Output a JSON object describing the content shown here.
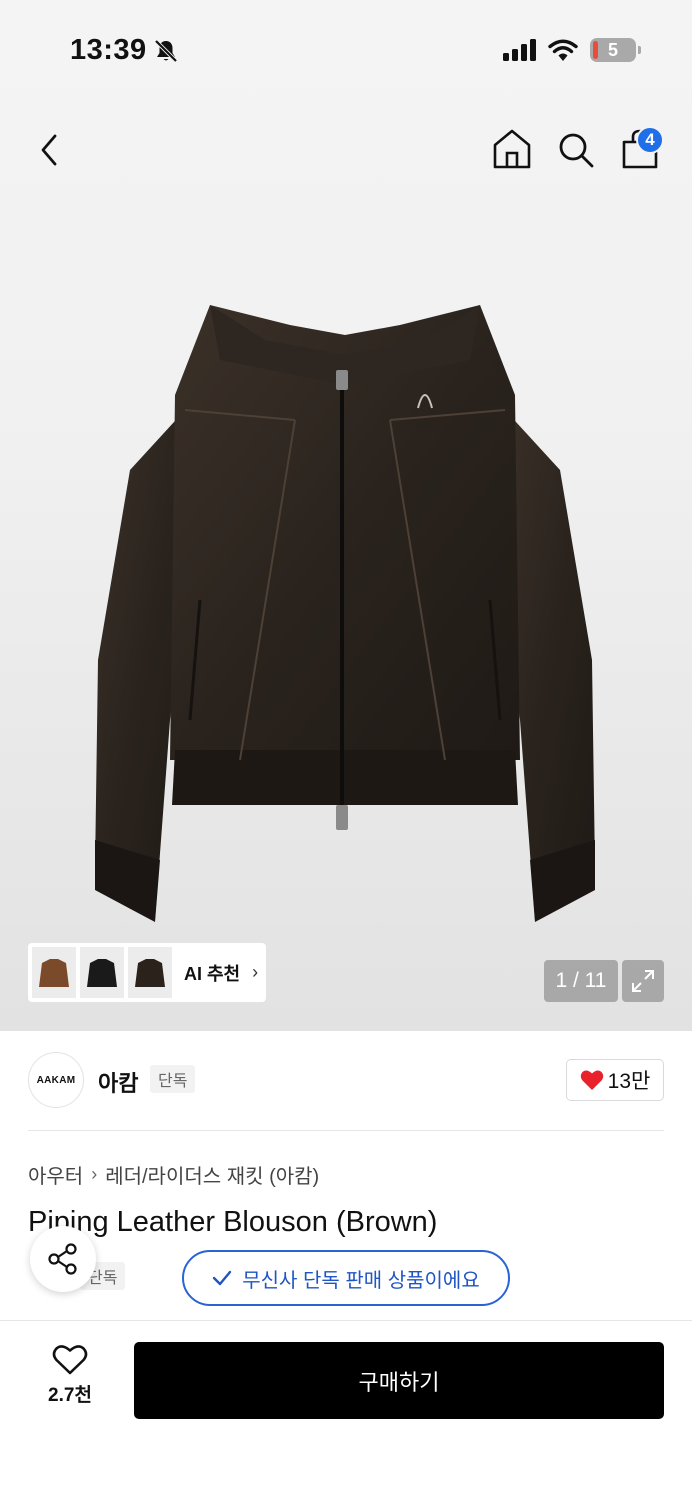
{
  "status_bar": {
    "time": "13:39",
    "battery": "5"
  },
  "nav": {
    "cart_count": "4"
  },
  "gallery": {
    "ai_label": "AI 추천",
    "pager": "1 / 11"
  },
  "brand": {
    "logo_text": "AAKAM",
    "name": "아캄",
    "tag": "단독",
    "likes": "13만"
  },
  "breadcrumb": {
    "category": "아우터",
    "subcategory": "레더/라이더스 재킷 (아캄)"
  },
  "product": {
    "title": "Piping Leather Blouson (Brown)",
    "exclusive_tag": "단독",
    "exclusive_notice": "무신사 단독 판매 상품이에요"
  },
  "footer": {
    "wish_count": "2.7천",
    "buy_label": "구매하기"
  },
  "colors": {
    "accent_blue": "#1f6fe8",
    "heart_red": "#e8212a",
    "buy_bg": "#000000"
  }
}
